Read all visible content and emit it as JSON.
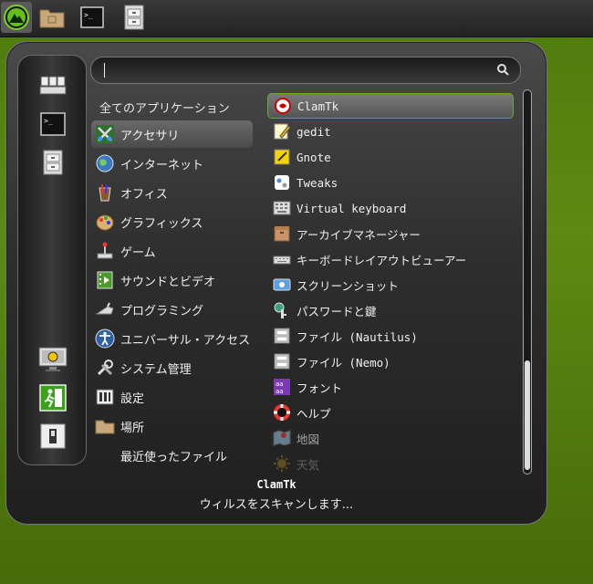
{
  "panel": {
    "buttons": [
      {
        "name": "menu-icon"
      },
      {
        "name": "folder-icon"
      },
      {
        "name": "terminal-icon"
      },
      {
        "name": "file-cabinet-icon"
      }
    ]
  },
  "sidebar": {
    "top": [
      {
        "name": "computer-icon"
      },
      {
        "name": "terminal-icon"
      },
      {
        "name": "file-cabinet-icon"
      }
    ],
    "bottom": [
      {
        "name": "lock-screen-icon"
      },
      {
        "name": "logout-icon"
      },
      {
        "name": "shutdown-icon"
      }
    ]
  },
  "search": {
    "value": ""
  },
  "categories_title": "全てのアプリケーション",
  "categories": [
    {
      "label": "アクセサリ",
      "icon": "accessories-icon",
      "selected": true
    },
    {
      "label": "インターネット",
      "icon": "internet-icon"
    },
    {
      "label": "オフィス",
      "icon": "office-icon"
    },
    {
      "label": "グラフィックス",
      "icon": "graphics-icon"
    },
    {
      "label": "ゲーム",
      "icon": "games-icon"
    },
    {
      "label": "サウンドとビデオ",
      "icon": "multimedia-icon"
    },
    {
      "label": "プログラミング",
      "icon": "programming-icon"
    },
    {
      "label": "ユニバーサル・アクセス",
      "icon": "accessibility-icon"
    },
    {
      "label": "システム管理",
      "icon": "system-tools-icon"
    },
    {
      "label": "設定",
      "icon": "settings-icon"
    },
    {
      "label": "場所",
      "icon": "places-icon"
    },
    {
      "label": "最近使ったファイル",
      "icon": ""
    }
  ],
  "apps": [
    {
      "label": "ClamTk",
      "icon": "clamtk-icon",
      "selected": true
    },
    {
      "label": "gedit",
      "icon": "gedit-icon"
    },
    {
      "label": "Gnote",
      "icon": "gnote-icon"
    },
    {
      "label": "Tweaks",
      "icon": "tweaks-icon"
    },
    {
      "label": "Virtual keyboard",
      "icon": "keyboard-icon"
    },
    {
      "label": "アーカイブマネージャー",
      "icon": "archive-icon"
    },
    {
      "label": "キーボードレイアウトビューアー",
      "icon": "keyboard-layout-icon"
    },
    {
      "label": "スクリーンショット",
      "icon": "screenshot-icon"
    },
    {
      "label": "パスワードと鍵",
      "icon": "password-icon"
    },
    {
      "label": "ファイル (Nautilus)",
      "icon": "file-manager-icon"
    },
    {
      "label": "ファイル (Nemo)",
      "icon": "file-manager-icon"
    },
    {
      "label": "フォント",
      "icon": "fonts-icon"
    },
    {
      "label": "ヘルプ",
      "icon": "help-icon"
    },
    {
      "label": "地図",
      "icon": "maps-icon"
    },
    {
      "label": "天気",
      "icon": "weather-icon"
    }
  ],
  "description": {
    "name": "ClamTk",
    "text": "ウィルスをスキャンします..."
  }
}
